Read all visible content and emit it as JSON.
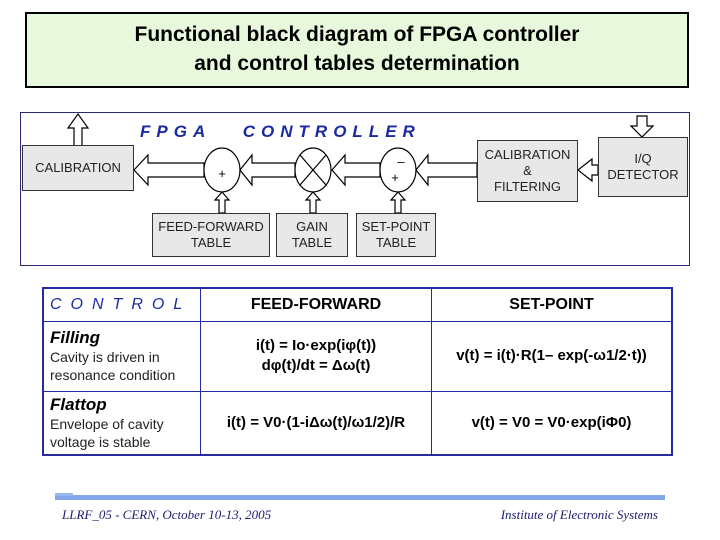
{
  "title": {
    "line1": "Functional black diagram of FPGA controller",
    "line2": "and control tables determination"
  },
  "diagram": {
    "heading": "FPGA   CONTROLLER",
    "calibration": "CALIBRATION",
    "cal_filter": [
      "CALIBRATION",
      "&",
      "FILTERING"
    ],
    "iq": [
      "I/Q",
      "DETECTOR"
    ],
    "ff_table": [
      "FEED-FORWARD",
      "TABLE"
    ],
    "gain_table": [
      "GAIN",
      "TABLE"
    ],
    "sp_table": [
      "SET-POINT",
      "TABLE"
    ],
    "sum1_sign": "+",
    "sum2_minus": "–",
    "sum2_plus": "+"
  },
  "table": {
    "headers": [
      "CONTROL",
      "FEED-FORWARD",
      "SET-POINT"
    ],
    "rows": [
      {
        "title": "Filling",
        "desc": "Cavity is driven in resonance condition",
        "ff1": "i(t) = Io·exp(iφ(t))",
        "ff2": "dφ(t)/dt = Δω(t)",
        "sp": "v(t) =  i(t)·R(1– exp(-ω1/2·t))"
      },
      {
        "title": "Flattop",
        "desc": "Envelope of  cavity voltage is stable",
        "ff1": "i(t)  =  V0·(1-iΔω(t)/ω1/2)/R",
        "sp": "v(t)  =  V0 =  V0·exp(iΦ0)"
      }
    ]
  },
  "footer": {
    "left": "LLRF_05 - CERN, October 10-13, 2005",
    "right": "Institute of Electronic Systems"
  },
  "colors": {
    "accent": "#1a2aa0",
    "title_bg": "#e8f8dc",
    "bar": "#84a6ea"
  }
}
